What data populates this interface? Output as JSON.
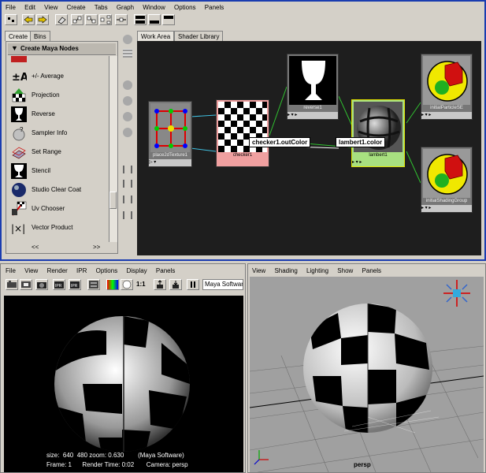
{
  "hypershade": {
    "menus": [
      "File",
      "Edit",
      "View",
      "Create",
      "Tabs",
      "Graph",
      "Window",
      "Options",
      "Panels"
    ],
    "left_tabs": [
      "Create",
      "Bins"
    ],
    "section_title": "Create Maya Nodes",
    "nodes_list": [
      {
        "label": "+/- Average",
        "icon": "plus-minus-average-icon"
      },
      {
        "label": "Projection",
        "icon": "projection-icon"
      },
      {
        "label": "Reverse",
        "icon": "reverse-icon"
      },
      {
        "label": "Sampler Info",
        "icon": "sampler-info-icon"
      },
      {
        "label": "Set Range",
        "icon": "set-range-icon"
      },
      {
        "label": "Stencil",
        "icon": "stencil-icon"
      },
      {
        "label": "Studio Clear Coat",
        "icon": "studio-clear-coat-icon"
      },
      {
        "label": "Uv Chooser",
        "icon": "uv-chooser-icon"
      },
      {
        "label": "Vector Product",
        "icon": "vector-product-icon"
      }
    ],
    "scroll_arrows": [
      "<<",
      ">>"
    ],
    "work_tabs": [
      "Work Area",
      "Shader Library"
    ],
    "graph_nodes": {
      "place2d": "place2dTexture1",
      "checker": "checker1",
      "reverse": "reverse1",
      "lambert": "lambert1",
      "particle": "initialParticleSE",
      "shading": "initialShadingGroup"
    },
    "connection_labels": {
      "out": "checker1.outColor",
      "in": "lambert1.color"
    }
  },
  "render_view": {
    "menus": [
      "File",
      "View",
      "Render",
      "IPR",
      "Options",
      "Display",
      "Panels"
    ],
    "ratio": "1:1",
    "renderer": "Maya Softwar",
    "info_line1": "size:  640  480 zoom: 0.630        (Maya Software)",
    "info_line2": "Frame: 1      Render Time: 0:02       Camera: persp"
  },
  "viewport": {
    "menus": [
      "View",
      "Shading",
      "Lighting",
      "Show",
      "Panels"
    ],
    "camera": "persp"
  },
  "colors": {
    "node_selected_green": "#a8e080",
    "node_checker_pink": "#f0a0a0",
    "connection_green": "#30c030",
    "connection_cyan": "#40c0e0",
    "active_border": "#1a3cb0"
  }
}
